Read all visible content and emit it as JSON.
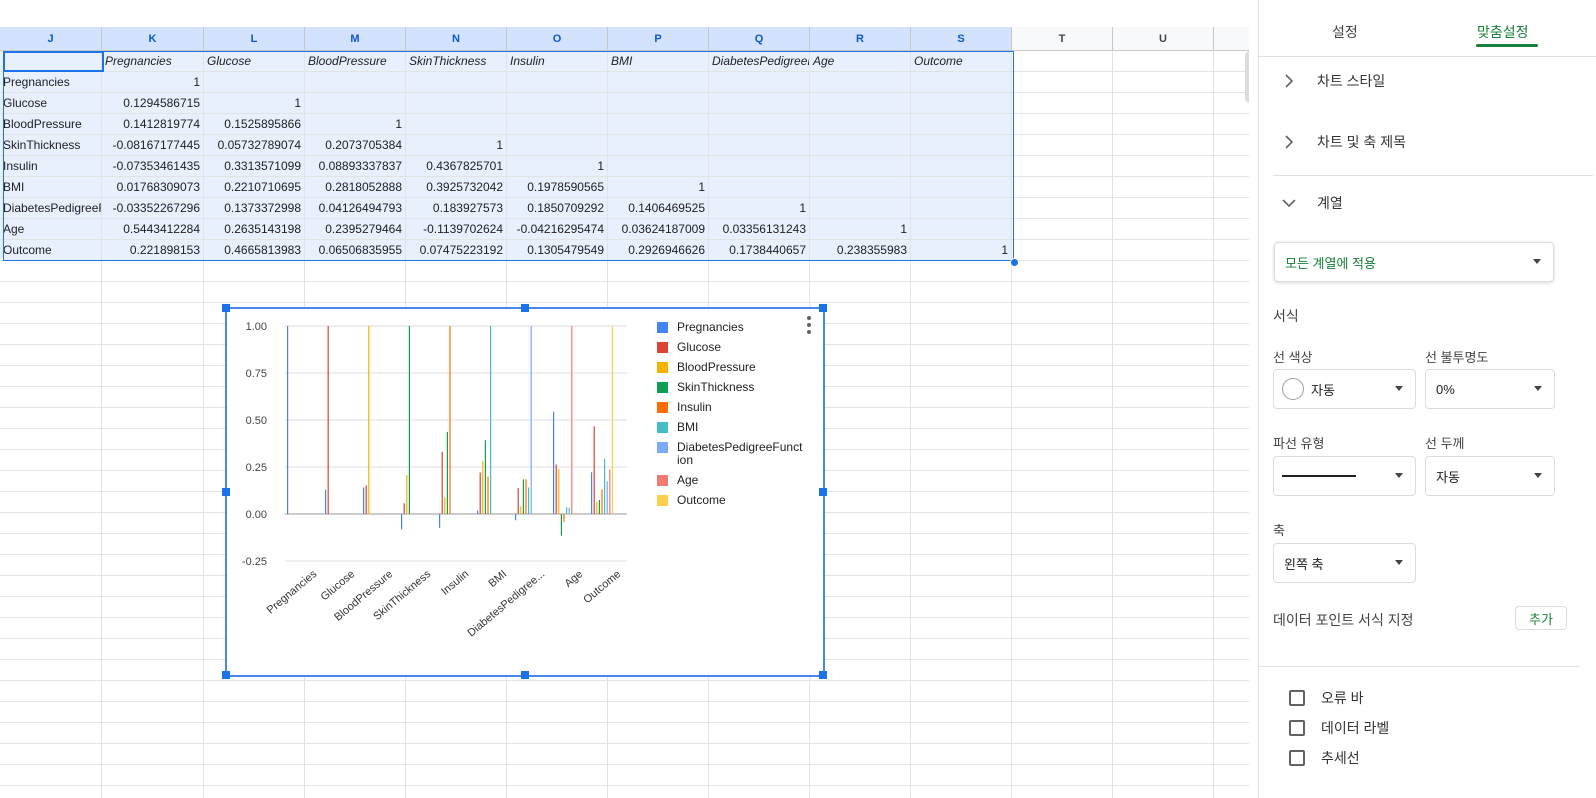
{
  "sheet": {
    "columns": [
      {
        "id": "J",
        "w": 102,
        "sel": true
      },
      {
        "id": "K",
        "w": 102,
        "sel": true
      },
      {
        "id": "L",
        "w": 101,
        "sel": true
      },
      {
        "id": "M",
        "w": 101,
        "sel": true
      },
      {
        "id": "N",
        "w": 101,
        "sel": true
      },
      {
        "id": "O",
        "w": 101,
        "sel": true
      },
      {
        "id": "P",
        "w": 101,
        "sel": true
      },
      {
        "id": "Q",
        "w": 101,
        "sel": true
      },
      {
        "id": "R",
        "w": 101,
        "sel": true
      },
      {
        "id": "S",
        "w": 101,
        "sel": true
      },
      {
        "id": "T",
        "w": 101,
        "sel": false
      },
      {
        "id": "U",
        "w": 101,
        "sel": false
      },
      {
        "id": "",
        "w": 36,
        "sel": false
      }
    ],
    "header_row": [
      "",
      "Pregnancies",
      "Glucose",
      "BloodPressure",
      "SkinThickness",
      "Insulin",
      "BMI",
      "DiabetesPedigreeFunction",
      "Age",
      "Outcome"
    ],
    "rows": [
      [
        "Pregnancies",
        "1",
        "",
        "",
        "",
        "",
        "",
        "",
        "",
        ""
      ],
      [
        "Glucose",
        "0.1294586715",
        "1",
        "",
        "",
        "",
        "",
        "",
        "",
        ""
      ],
      [
        "BloodPressure",
        "0.1412819774",
        "0.1525895866",
        "1",
        "",
        "",
        "",
        "",
        "",
        ""
      ],
      [
        "SkinThickness",
        "-0.08167177445",
        "0.05732789074",
        "0.2073705384",
        "1",
        "",
        "",
        "",
        "",
        ""
      ],
      [
        "Insulin",
        "-0.07353461435",
        "0.3313571099",
        "0.08893337837",
        "0.4367825701",
        "1",
        "",
        "",
        "",
        ""
      ],
      [
        "BMI",
        "0.01768309073",
        "0.2210710695",
        "0.2818052888",
        "0.3925732042",
        "0.1978590565",
        "1",
        "",
        "",
        ""
      ],
      [
        "DiabetesPedigreeFunction",
        "-0.03352267296",
        "0.1373372998",
        "0.04126494793",
        "0.183927573",
        "0.1850709292",
        "0.1406469525",
        "1",
        "",
        ""
      ],
      [
        "Age",
        "0.5443412284",
        "0.2635143198",
        "0.2395279464",
        "-0.1139702624",
        "-0.04216295474",
        "0.03624187009",
        "0.03356131243",
        "1",
        ""
      ],
      [
        "Outcome",
        "0.221898153",
        "0.4665813983",
        "0.06506835955",
        "0.07475223192",
        "0.1305479549",
        "0.2926946626",
        "0.1738440657",
        "0.238355983",
        "1"
      ]
    ],
    "empty_rows": 26
  },
  "chart_data": {
    "type": "bar",
    "categories": [
      "Pregnancies",
      "Glucose",
      "BloodPressure",
      "SkinThickness",
      "Insulin",
      "BMI",
      "DiabetesPedigree...",
      "Age",
      "Outcome"
    ],
    "ylim": [
      -0.25,
      1.0
    ],
    "yticks": [
      "1.00",
      "0.75",
      "0.50",
      "0.25",
      "0.00",
      "-0.25"
    ],
    "grid": true,
    "legend_position": "right",
    "series": [
      {
        "name": "Pregnancies",
        "color": "#4285f4",
        "values": [
          1,
          0.1294586715,
          0.1412819774,
          -0.08167177445,
          -0.07353461435,
          0.01768309073,
          -0.03352267296,
          0.5443412284,
          0.221898153
        ]
      },
      {
        "name": "Glucose",
        "color": "#db4437",
        "values": [
          0,
          1,
          0.1525895866,
          0.05732789074,
          0.3313571099,
          0.2210710695,
          0.1373372998,
          0.2635143198,
          0.4665813983
        ]
      },
      {
        "name": "BloodPressure",
        "color": "#f4b400",
        "values": [
          0,
          0,
          1,
          0.2073705384,
          0.08893337837,
          0.2818052888,
          0.04126494793,
          0.2395279464,
          0.06506835955
        ]
      },
      {
        "name": "SkinThickness",
        "color": "#0f9d58",
        "values": [
          0,
          0,
          0,
          1,
          0.4367825701,
          0.3925732042,
          0.183927573,
          -0.1139702624,
          0.07475223192
        ]
      },
      {
        "name": "Insulin",
        "color": "#ff6d00",
        "values": [
          0,
          0,
          0,
          0,
          1,
          0.1978590565,
          0.1850709292,
          -0.04216295474,
          0.1305479549
        ]
      },
      {
        "name": "BMI",
        "color": "#46bdc6",
        "values": [
          0,
          0,
          0,
          0,
          0,
          1,
          0.1406469525,
          0.03624187009,
          0.2926946626
        ]
      },
      {
        "name": "DiabetesPedigreeFunction",
        "color": "#7baaf7",
        "values": [
          0,
          0,
          0,
          0,
          0,
          0,
          1,
          0.03356131243,
          0.1738440657
        ]
      },
      {
        "name": "Age",
        "color": "#f07b72",
        "values": [
          0,
          0,
          0,
          0,
          0,
          0,
          0,
          1,
          0.238355983
        ]
      },
      {
        "name": "Outcome",
        "color": "#fcd04f",
        "values": [
          0,
          0,
          0,
          0,
          0,
          0,
          0,
          0,
          1
        ]
      }
    ]
  },
  "panel": {
    "tab_setup": "설정",
    "tab_customize": "맞춤설정",
    "section_chart_style": "차트 스타일",
    "section_titles": "차트 및 축 제목",
    "section_series": "계열",
    "apply_to": "모든 계열에 적용",
    "format_label": "서식",
    "line_color_label": "선 색상",
    "line_color_value": "자동",
    "line_opacity_label": "선 불투명도",
    "line_opacity_value": "0%",
    "dash_type_label": "파선 유형",
    "line_thickness_label": "선 두께",
    "line_thickness_value": "자동",
    "axis_label": "축",
    "axis_value": "왼쪽 축",
    "data_point_format_label": "데이터 포인트 서식 지정",
    "add_button": "추가",
    "error_bars": "오류 바",
    "data_labels": "데이터 라벨",
    "trendline": "추세선"
  }
}
